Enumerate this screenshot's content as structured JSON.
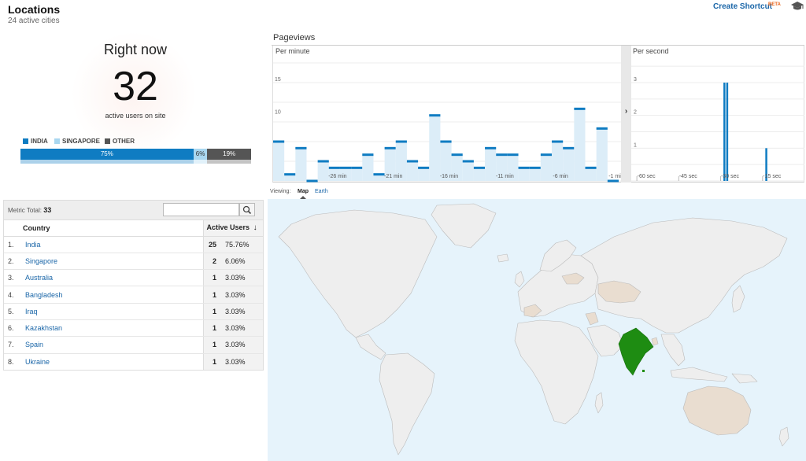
{
  "header": {
    "title": "Locations",
    "subtitle": "24 active cities",
    "shortcut_label": "Create Shortcut",
    "beta_label": "BETA"
  },
  "right_now": {
    "title": "Right now",
    "count": "32",
    "label": "active users on site"
  },
  "legend": [
    {
      "label": "INDIA",
      "color": "#0f7cc2"
    },
    {
      "label": "SINGAPORE",
      "color": "#a9d7f0"
    },
    {
      "label": "OTHER",
      "color": "#555555"
    }
  ],
  "share_bar": [
    {
      "label": "75%",
      "value": 75,
      "color": "#0f7cc2",
      "text_color": "#ffffff"
    },
    {
      "label": "6%",
      "value": 6,
      "color": "#a9d7f0",
      "text_color": "#333333"
    },
    {
      "label": "19%",
      "value": 19,
      "color": "#555555",
      "text_color": "#ffffff"
    }
  ],
  "pageviews": {
    "title": "Pageviews",
    "viewing_label": "Viewing:",
    "tabs": [
      "Map",
      "Earth"
    ],
    "per_minute_title": "Per minute",
    "per_second_title": "Per second"
  },
  "chart_data": [
    {
      "type": "bar",
      "title": "Per minute",
      "x": [
        -30,
        -29,
        -28,
        -27,
        -26,
        -25,
        -24,
        -23,
        -22,
        -21,
        -20,
        -19,
        -18,
        -17,
        -16,
        -15,
        -14,
        -13,
        -12,
        -11,
        -10,
        -9,
        -8,
        -7,
        -6,
        -5,
        -4,
        -3,
        -2,
        -1
      ],
      "values": [
        6,
        1,
        5,
        0,
        3,
        2,
        2,
        2,
        4,
        1,
        5,
        6,
        3,
        2,
        10,
        6,
        4,
        3,
        2,
        5,
        4,
        4,
        2,
        2,
        4,
        6,
        5,
        11,
        2,
        8,
        0
      ],
      "x_tick_labels": [
        "-26 min",
        "-21 min",
        "-16 min",
        "-11 min",
        "-6 min",
        "-1 min"
      ],
      "y_tick_labels": [
        "5",
        "10",
        "15"
      ],
      "ylim": [
        0,
        18
      ]
    },
    {
      "type": "bar",
      "title": "Per second",
      "x_ticks": [
        -60,
        -45,
        -30,
        -15
      ],
      "x_tick_labels": [
        "-60 sec",
        "-45 sec",
        "-30 sec",
        "-15 sec"
      ],
      "y_tick_labels": [
        "1",
        "2",
        "3"
      ],
      "points": [
        {
          "x": -29,
          "y": 3
        },
        {
          "x": -28,
          "y": 3
        },
        {
          "x": -14,
          "y": 1
        }
      ],
      "xlim": [
        -62,
        0
      ],
      "ylim": [
        0,
        3.6
      ]
    }
  ],
  "table": {
    "metric_total_label": "Metric Total:",
    "metric_total": "33",
    "columns": [
      "Country",
      "Active Users"
    ],
    "rows": [
      {
        "index": "1.",
        "country": "India",
        "users": "25",
        "percent": "75.76%"
      },
      {
        "index": "2.",
        "country": "Singapore",
        "users": "2",
        "percent": "6.06%"
      },
      {
        "index": "3.",
        "country": "Australia",
        "users": "1",
        "percent": "3.03%"
      },
      {
        "index": "4.",
        "country": "Bangladesh",
        "users": "1",
        "percent": "3.03%"
      },
      {
        "index": "5.",
        "country": "Iraq",
        "users": "1",
        "percent": "3.03%"
      },
      {
        "index": "6.",
        "country": "Kazakhstan",
        "users": "1",
        "percent": "3.03%"
      },
      {
        "index": "7.",
        "country": "Spain",
        "users": "1",
        "percent": "3.03%"
      },
      {
        "index": "8.",
        "country": "Ukraine",
        "users": "1",
        "percent": "3.03%"
      }
    ]
  },
  "map": {
    "ocean_color": "#e6f3fb",
    "land_color": "#eeeeee",
    "active_low_color": "#e9ddd0",
    "active_high_color": "#1e8c12",
    "border_color": "#bbbbbb"
  }
}
